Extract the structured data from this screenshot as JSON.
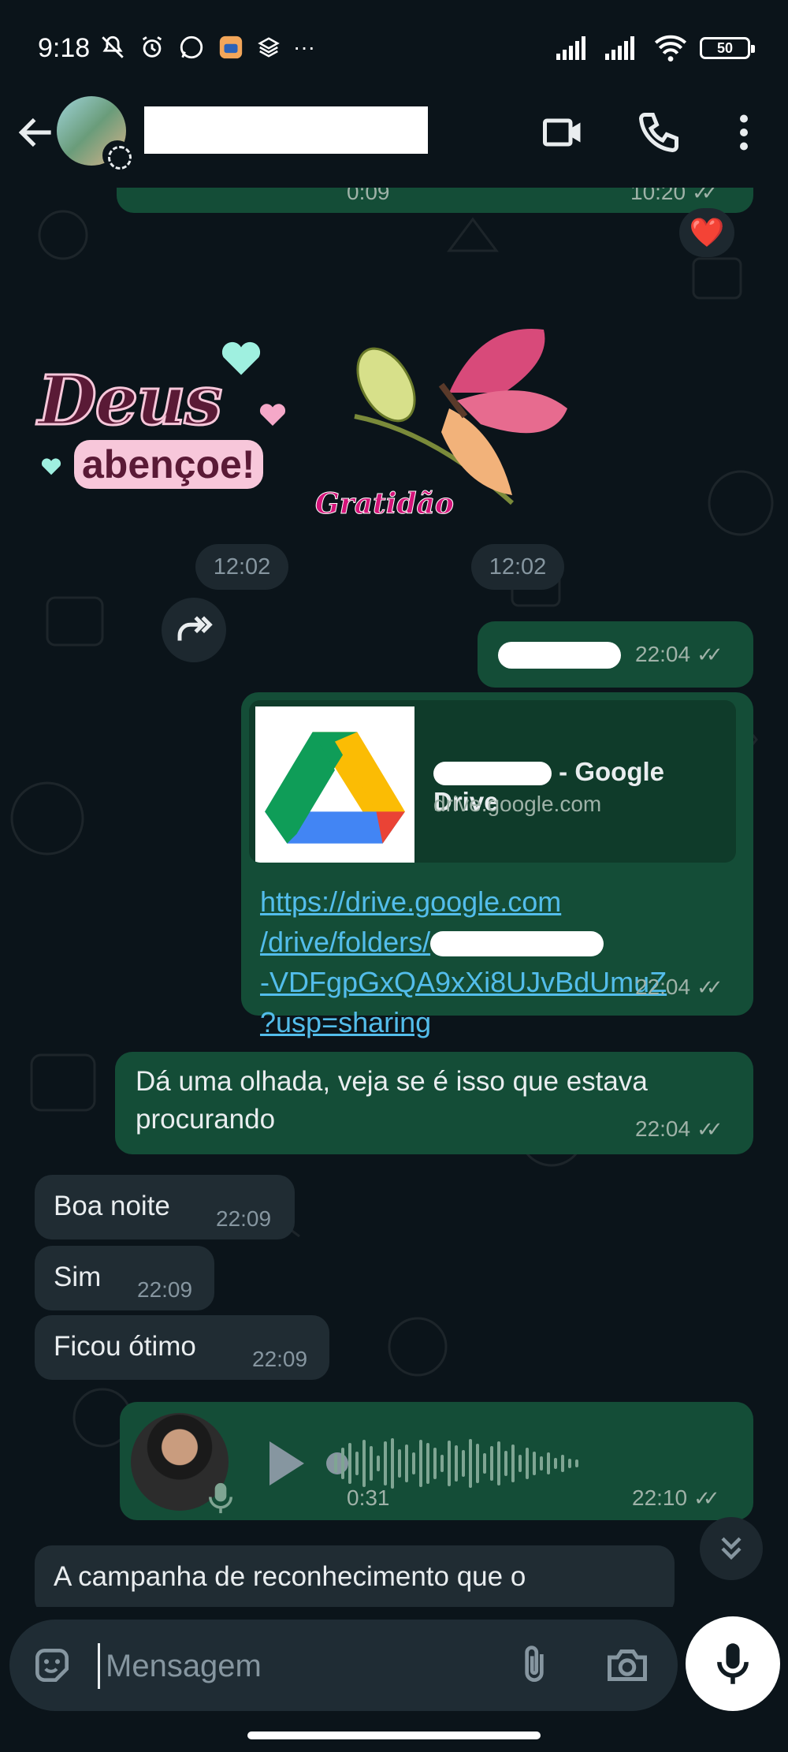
{
  "status_bar": {
    "time": "9:18",
    "battery": "50",
    "left_icons": [
      "mute-icon",
      "alarm-icon",
      "whatsapp-icon",
      "app-icon",
      "layers-icon",
      "more-dots"
    ],
    "right_icons": [
      "signal-icon",
      "signal-icon",
      "wifi-icon",
      "battery-icon"
    ]
  },
  "header": {
    "contact_name": "",
    "icons": [
      "back-arrow-icon",
      "video-call-icon",
      "voice-call-icon",
      "more-vert-icon"
    ]
  },
  "colors": {
    "background": "#0b141a",
    "outgoing_bubble": "#144d37",
    "incoming_bubble": "#202c33",
    "link": "#53bdeb",
    "read_ticks": "#9fb2a8"
  },
  "messages": {
    "top_audio": {
      "duration": "0:09",
      "time": "10:20",
      "reaction": "❤️"
    },
    "stickers": {
      "sticker1_line1": "Deus",
      "sticker1_line2": "abençoe!",
      "sticker2_caption": "Gratidão",
      "time1": "12:02",
      "time2": "12:02"
    },
    "redacted_msg": {
      "time": "22:04"
    },
    "drive_link": {
      "preview_title_suffix": "- Google Drive",
      "preview_domain": "drive.google.com",
      "url_line1": "https://drive.google.com",
      "url_line2": "/drive/folders/",
      "url_line3": "-VDFgpGxQA9xXi8UJvBdUmuZ",
      "url_line4": "?usp=sharing",
      "time": "22:04"
    },
    "look_msg": {
      "line1": "Dá uma olhada, veja se é isso que estava",
      "line2": "procurando",
      "time": "22:04"
    },
    "incoming": [
      {
        "text": "Boa noite",
        "time": "22:09"
      },
      {
        "text": "Sim",
        "time": "22:09"
      },
      {
        "text": "Ficou ótimo",
        "time": "22:09"
      }
    ],
    "voice_note": {
      "duration": "0:31",
      "time": "22:10"
    },
    "partial_incoming": {
      "text": "A campanha de reconhecimento que o"
    }
  },
  "composer": {
    "placeholder": "Mensagem",
    "icons": [
      "emoji-icon",
      "attach-icon",
      "camera-icon",
      "mic-icon"
    ]
  }
}
